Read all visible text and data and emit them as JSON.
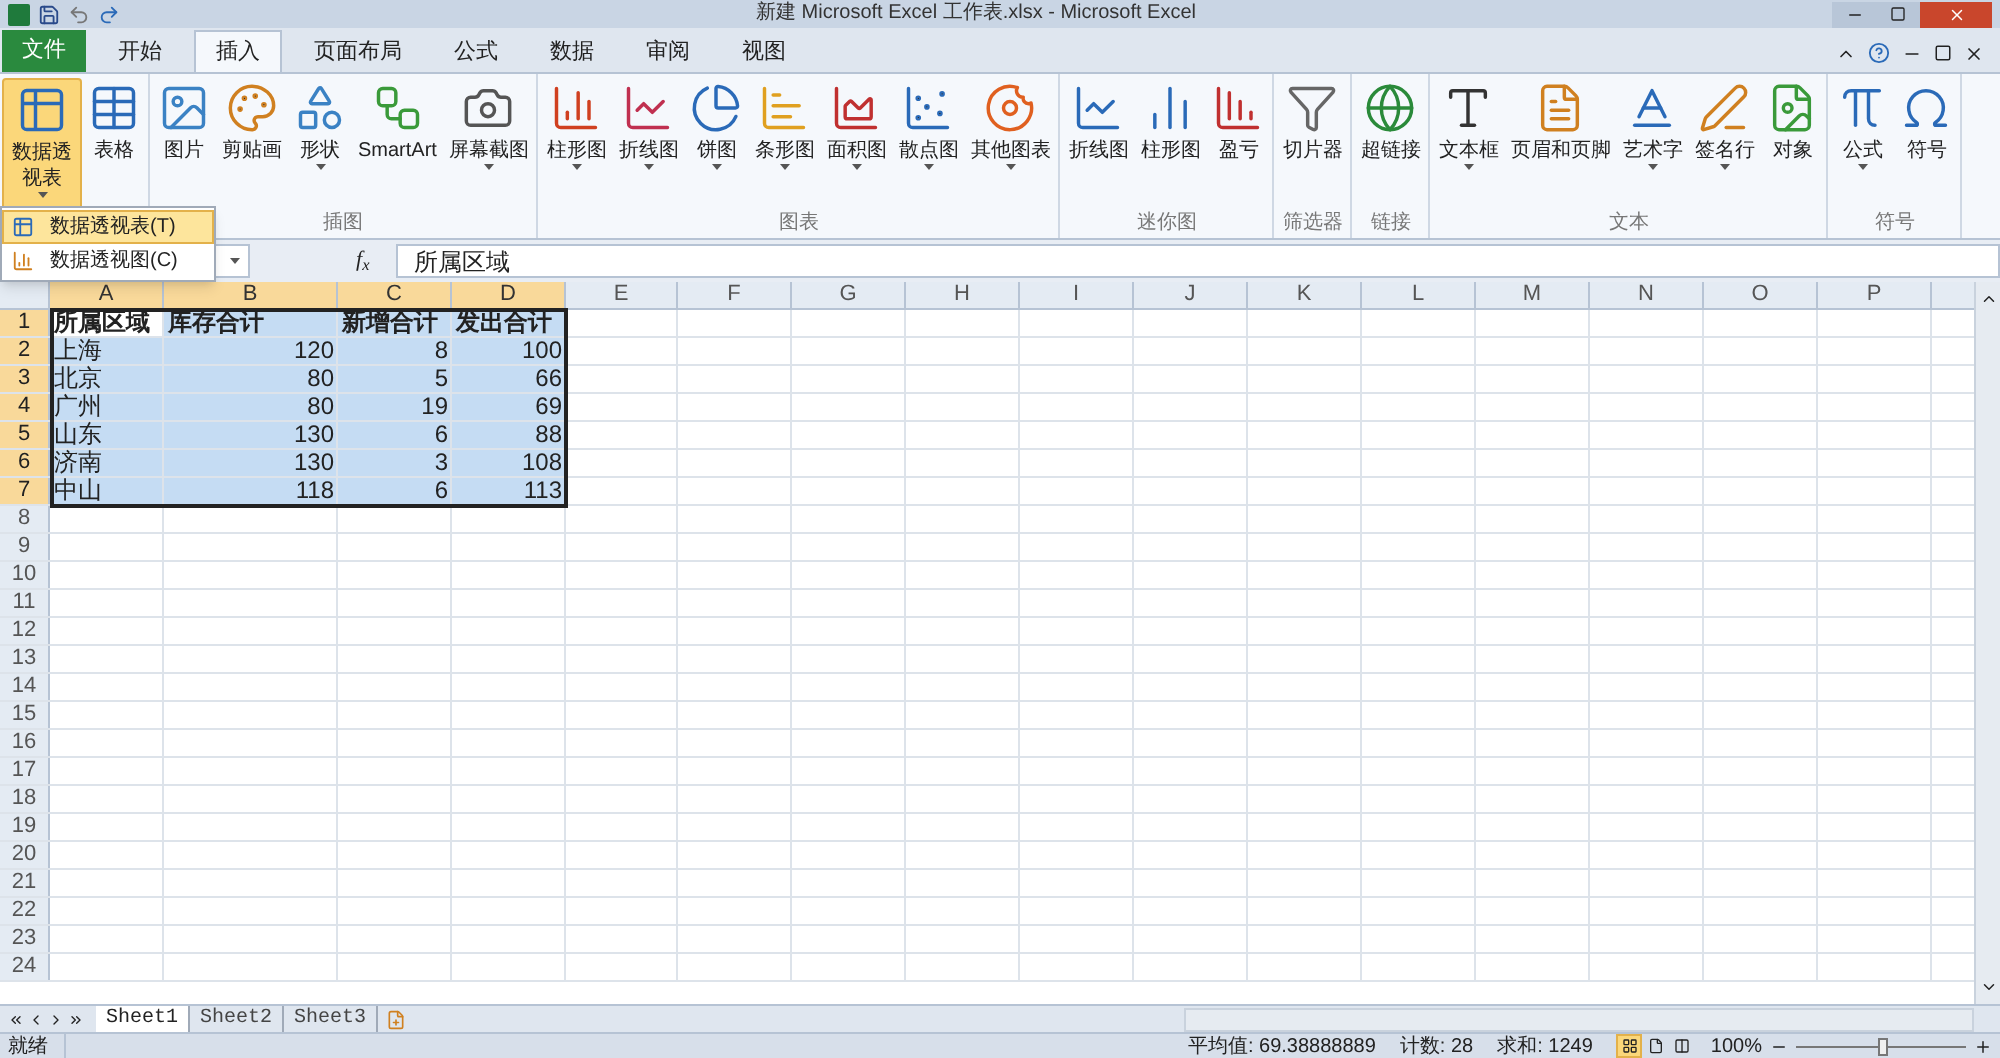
{
  "window": {
    "title": "新建 Microsoft Excel 工作表.xlsx - Microsoft Excel"
  },
  "tabs": [
    {
      "label": "文件",
      "kind": "file",
      "selected": false
    },
    {
      "label": "开始",
      "kind": "tab",
      "selected": false
    },
    {
      "label": "插入",
      "kind": "tab",
      "selected": true
    },
    {
      "label": "页面布局",
      "kind": "tab",
      "selected": false
    },
    {
      "label": "公式",
      "kind": "tab",
      "selected": false
    },
    {
      "label": "数据",
      "kind": "tab",
      "selected": false
    },
    {
      "label": "审阅",
      "kind": "tab",
      "selected": false
    },
    {
      "label": "视图",
      "kind": "tab",
      "selected": false
    }
  ],
  "ribbon_groups": [
    {
      "items": [
        {
          "label": "数据透视表",
          "dropdown": true,
          "pressed": true
        },
        {
          "label": "表格",
          "dropdown": false,
          "pressed": false
        }
      ]
    },
    {
      "label": "插图",
      "items": [
        {
          "label": "图片",
          "dropdown": false,
          "pressed": false
        },
        {
          "label": "剪贴画",
          "dropdown": false,
          "pressed": false
        },
        {
          "label": "形状",
          "dropdown": true,
          "pressed": false
        },
        {
          "label": "SmartArt",
          "dropdown": false,
          "pressed": false
        },
        {
          "label": "屏幕截图",
          "dropdown": true,
          "pressed": false
        }
      ]
    },
    {
      "label": "图表",
      "items": [
        {
          "label": "柱形图",
          "dropdown": true,
          "pressed": false
        },
        {
          "label": "折线图",
          "dropdown": true,
          "pressed": false
        },
        {
          "label": "饼图",
          "dropdown": true,
          "pressed": false
        },
        {
          "label": "条形图",
          "dropdown": true,
          "pressed": false
        },
        {
          "label": "面积图",
          "dropdown": true,
          "pressed": false
        },
        {
          "label": "散点图",
          "dropdown": true,
          "pressed": false
        },
        {
          "label": "其他图表",
          "dropdown": true,
          "pressed": false
        }
      ]
    },
    {
      "label": "迷你图",
      "items": [
        {
          "label": "折线图",
          "dropdown": false,
          "pressed": false
        },
        {
          "label": "柱形图",
          "dropdown": false,
          "pressed": false
        },
        {
          "label": "盈亏",
          "dropdown": false,
          "pressed": false
        }
      ]
    },
    {
      "label": "筛选器",
      "items": [
        {
          "label": "切片器",
          "dropdown": false,
          "pressed": false
        }
      ]
    },
    {
      "label": "链接",
      "items": [
        {
          "label": "超链接",
          "dropdown": false,
          "pressed": false
        }
      ]
    },
    {
      "label": "文本",
      "items": [
        {
          "label": "文本框",
          "dropdown": true,
          "pressed": false
        },
        {
          "label": "页眉和页脚",
          "dropdown": false,
          "pressed": false
        },
        {
          "label": "艺术字",
          "dropdown": true,
          "pressed": false
        },
        {
          "label": "签名行",
          "dropdown": true,
          "pressed": false
        },
        {
          "label": "对象",
          "dropdown": false,
          "pressed": false
        }
      ]
    },
    {
      "label": "符号",
      "items": [
        {
          "label": "公式",
          "dropdown": true,
          "pressed": false
        },
        {
          "label": "符号",
          "dropdown": false,
          "pressed": false
        }
      ]
    }
  ],
  "dropdown_menu": [
    {
      "label": "数据透视表(T)",
      "selected": true
    },
    {
      "label": "数据透视图(C)",
      "selected": false
    }
  ],
  "formula_bar": {
    "function_label": "f$_{x}$",
    "value": "所属区域"
  },
  "columns": [
    {
      "label": "A",
      "selected": true
    },
    {
      "label": "B",
      "selected": true
    },
    {
      "label": "C",
      "selected": true
    },
    {
      "label": "D",
      "selected": true
    },
    {
      "label": "E",
      "selected": false
    },
    {
      "label": "F",
      "selected": false
    },
    {
      "label": "G",
      "selected": false
    },
    {
      "label": "H",
      "selected": false
    },
    {
      "label": "I",
      "selected": false
    },
    {
      "label": "J",
      "selected": false
    },
    {
      "label": "K",
      "selected": false
    },
    {
      "label": "L",
      "selected": false
    },
    {
      "label": "M",
      "selected": false
    },
    {
      "label": "N",
      "selected": false
    },
    {
      "label": "O",
      "selected": false
    },
    {
      "label": "P",
      "selected": false
    }
  ],
  "rows": [
    {
      "number": "1",
      "selected": true,
      "cells": [
        {
          "text": "所属区域",
          "kind": "header",
          "active": true
        },
        {
          "text": "库存合计",
          "kind": "header",
          "active": false
        },
        {
          "text": "新增合计",
          "kind": "header",
          "active": false
        },
        {
          "text": "发出合计",
          "kind": "header",
          "active": false
        }
      ]
    },
    {
      "number": "2",
      "selected": true,
      "cells": [
        {
          "text": "上海",
          "kind": "text",
          "active": false
        },
        {
          "text": "120",
          "kind": "number",
          "active": false
        },
        {
          "text": "8",
          "kind": "number",
          "active": false
        },
        {
          "text": "100",
          "kind": "number",
          "active": false
        }
      ]
    },
    {
      "number": "3",
      "selected": true,
      "cells": [
        {
          "text": "北京",
          "kind": "text",
          "active": false
        },
        {
          "text": "80",
          "kind": "number",
          "active": false
        },
        {
          "text": "5",
          "kind": "number",
          "active": false
        },
        {
          "text": "66",
          "kind": "number",
          "active": false
        }
      ]
    },
    {
      "number": "4",
      "selected": true,
      "cells": [
        {
          "text": "广州",
          "kind": "text",
          "active": false
        },
        {
          "text": "80",
          "kind": "number",
          "active": false
        },
        {
          "text": "19",
          "kind": "number",
          "active": false
        },
        {
          "text": "69",
          "kind": "number",
          "active": false
        }
      ]
    },
    {
      "number": "5",
      "selected": true,
      "cells": [
        {
          "text": "山东",
          "kind": "text",
          "active": false
        },
        {
          "text": "130",
          "kind": "number",
          "active": false
        },
        {
          "text": "6",
          "kind": "number",
          "active": false
        },
        {
          "text": "88",
          "kind": "number",
          "active": false
        }
      ]
    },
    {
      "number": "6",
      "selected": true,
      "cells": [
        {
          "text": "济南",
          "kind": "text",
          "active": false
        },
        {
          "text": "130",
          "kind": "number",
          "active": false
        },
        {
          "text": "3",
          "kind": "number",
          "active": false
        },
        {
          "text": "108",
          "kind": "number",
          "active": false
        }
      ]
    },
    {
      "number": "7",
      "selected": true,
      "cells": [
        {
          "text": "中山",
          "kind": "text",
          "active": false
        },
        {
          "text": "118",
          "kind": "number",
          "active": false
        },
        {
          "text": "6",
          "kind": "number",
          "active": false
        },
        {
          "text": "113",
          "kind": "number",
          "active": false
        }
      ]
    },
    {
      "number": "8",
      "selected": false
    },
    {
      "number": "9",
      "selected": false
    },
    {
      "number": "10",
      "selected": false
    },
    {
      "number": "11",
      "selected": false
    },
    {
      "number": "12",
      "selected": false
    },
    {
      "number": "13",
      "selected": false
    },
    {
      "number": "14",
      "selected": false
    },
    {
      "number": "15",
      "selected": false
    },
    {
      "number": "16",
      "selected": false
    },
    {
      "number": "17",
      "selected": false
    },
    {
      "number": "18",
      "selected": false
    },
    {
      "number": "19",
      "selected": false
    },
    {
      "number": "20",
      "selected": false
    },
    {
      "number": "21",
      "selected": false
    },
    {
      "number": "22",
      "selected": false
    },
    {
      "number": "23",
      "selected": false
    },
    {
      "number": "24",
      "selected": false
    }
  ],
  "sheet_tabs": [
    {
      "label": "Sheet1",
      "selected": true
    },
    {
      "label": "Sheet2",
      "selected": false
    },
    {
      "label": "Sheet3",
      "selected": false
    }
  ],
  "status_bar": {
    "state": "就绪",
    "average": "平均值: 69.38888889",
    "count": "计数: 28",
    "sum": "求和: 1249",
    "views": [
      {
        "selected": true
      },
      {
        "selected": false
      },
      {
        "selected": false
      }
    ],
    "zoom": "100%",
    "zoom_level": {
      "level": 0.5
    }
  }
}
